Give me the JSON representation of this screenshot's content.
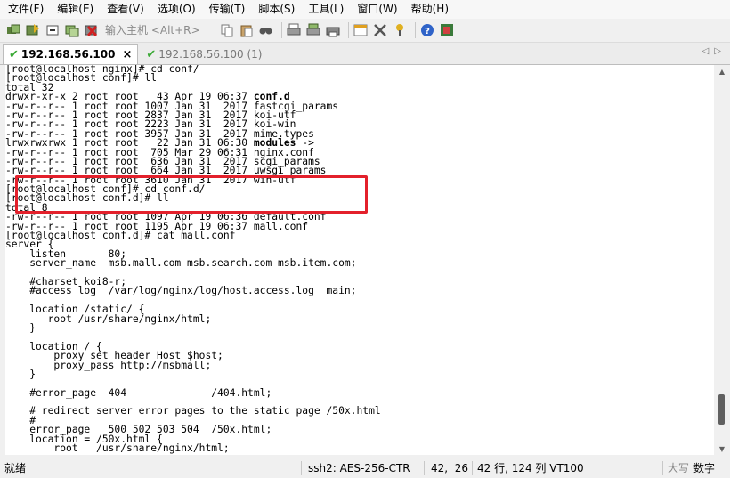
{
  "menubar": {
    "items": [
      "文件(F)",
      "编辑(E)",
      "查看(V)",
      "选项(O)",
      "传输(T)",
      "脚本(S)",
      "工具(L)",
      "窗口(W)",
      "帮助(H)"
    ]
  },
  "toolbar": {
    "host_placeholder": "输入主机 <Alt+R>",
    "icons": [
      "connect-icon",
      "quick-connect-icon",
      "reconnect-icon",
      "clone-icon",
      "disconnect-icon",
      "copy-icon",
      "paste-icon",
      "find-icon",
      "print-icon",
      "print-setup-icon",
      "session-options-icon",
      "global-options-icon",
      "keymap-icon",
      "help-icon",
      "sftp-icon"
    ]
  },
  "tabs": [
    {
      "label": "192.168.56.100",
      "active": true,
      "close": "×"
    },
    {
      "label": "192.168.56.100 (1)",
      "active": false
    }
  ],
  "terminal": {
    "lines": [
      "[root@localhost nginx]# cd conf/",
      "[root@localhost conf]# ll",
      "total 32",
      "drwxr-xr-x 2 root root   43 Apr 19 06:37 conf.d",
      "-rw-r--r-- 1 root root 1007 Jan 31  2017 fastcgi_params",
      "-rw-r--r-- 1 root root 2837 Jan 31  2017 koi-utf",
      "-rw-r--r-- 1 root root 2223 Jan 31  2017 koi-win",
      "-rw-r--r-- 1 root root 3957 Jan 31  2017 mime.types",
      "lrwxrwxrwx 1 root root   22 Jan 31 06:30 modules -> ",
      "-rw-r--r-- 1 root root  705 Mar 29 06:31 nginx.conf",
      "-rw-r--r-- 1 root root  636 Jan 31  2017 scgi_params",
      "-rw-r--r-- 1 root root  664 Jan 31  2017 uwsgi_params",
      "-rw-r--r-- 1 root root 3610 Jan 31  2017 win-utf",
      "[root@localhost conf]# cd conf.d/",
      "[root@localhost conf.d]# ll",
      "total 8",
      "-rw-r--r-- 1 root root 1097 Apr 19 06:36 default.conf",
      "-rw-r--r-- 1 root root 1195 Apr 19 06:37 mall.conf",
      "[root@localhost conf.d]# cat mall.conf",
      "server {",
      "    listen       80;",
      "    server_name  msb.mall.com msb.search.com msb.item.com;",
      "",
      "    #charset koi8-r;",
      "    #access_log  /var/log/nginx/log/host.access.log  main;",
      "",
      "    location /static/ {",
      "       root /usr/share/nginx/html;",
      "    }",
      "",
      "    location / {",
      "        proxy_set_header Host $host;",
      "        proxy_pass http://msbmall;",
      "    }",
      "",
      "    #error_page  404              /404.html;",
      "",
      "    # redirect server error pages to the static page /50x.html",
      "    #",
      "    error_page   500 502 503 504  /50x.html;",
      "    location = /50x.html {",
      "        root   /usr/share/nginx/html;"
    ]
  },
  "statusbar": {
    "ready": "就绪",
    "cipher": "ssh2: AES-256-CTR",
    "cursor": "42,  26",
    "size": "42 行, 124 列 VT100",
    "caps": "大写",
    "num": "数字"
  },
  "colors": {
    "highlight": "#e3202b",
    "tab_check": "#3aa935"
  }
}
